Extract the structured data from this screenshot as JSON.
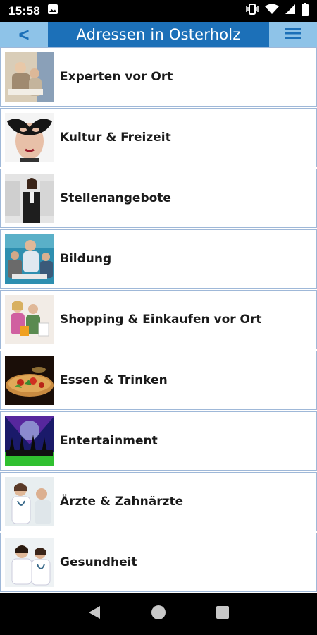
{
  "status_bar": {
    "time": "15:58",
    "icons": [
      "image-icon",
      "vibrate-icon",
      "wifi-icon",
      "signal-icon",
      "battery-icon"
    ]
  },
  "app_bar": {
    "back_label": "<",
    "title": "Adressen in Osterholz",
    "menu_icon": "hamburger-menu-icon",
    "color": "#1c70b8",
    "button_color": "#8ec3e8"
  },
  "categories": [
    {
      "label": "Experten vor Ort"
    },
    {
      "label": "Kultur & Freizeit"
    },
    {
      "label": "Stellenangebote"
    },
    {
      "label": "Bildung"
    },
    {
      "label": "Shopping & Einkaufen vor Ort"
    },
    {
      "label": "Essen & Trinken"
    },
    {
      "label": "Entertainment"
    },
    {
      "label": "Ärzte & Zahnärzte"
    },
    {
      "label": "Gesundheit"
    }
  ],
  "nav_bar": {
    "icons": [
      "back-triangle-icon",
      "home-circle-icon",
      "recents-square-icon"
    ]
  }
}
